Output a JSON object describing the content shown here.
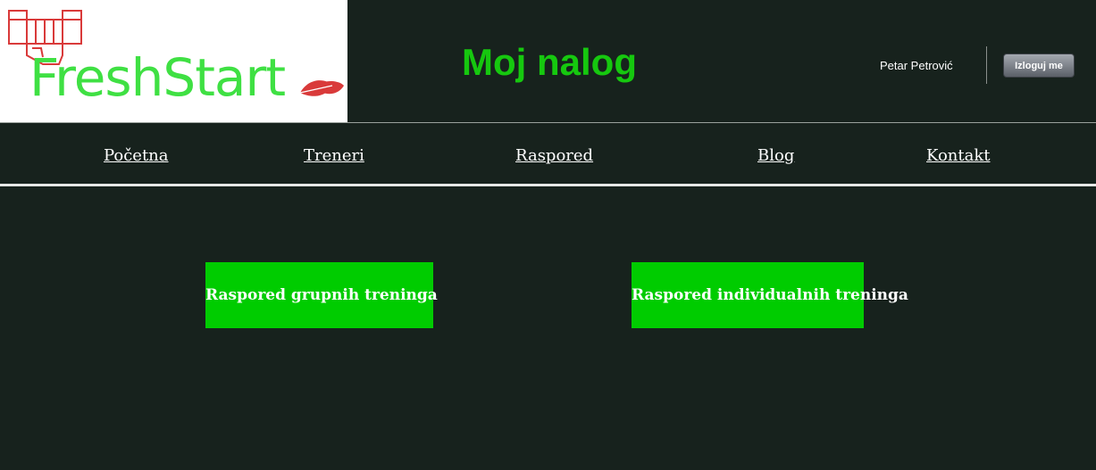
{
  "header": {
    "logo_text": "FreshStart",
    "page_title": "Moj nalog",
    "user_name": "Petar Petrović",
    "logout_label": "Izloguj me"
  },
  "nav": {
    "items": [
      {
        "label": "Početna"
      },
      {
        "label": "Treneri"
      },
      {
        "label": "Raspored"
      },
      {
        "label": "Blog"
      },
      {
        "label": "Kontakt"
      }
    ]
  },
  "main": {
    "buttons": [
      {
        "label": "Raspored grupnih treninga"
      },
      {
        "label": "Raspored individualnih treninga"
      }
    ]
  },
  "colors": {
    "background": "#17221d",
    "accent_green": "#00cc00",
    "title_green": "#16c80f",
    "logo_green": "#3fe043",
    "logo_red": "#d93a3a"
  },
  "icons": {
    "logo_mark": "fist-icon",
    "logo_leaf": "leaf-icon"
  }
}
